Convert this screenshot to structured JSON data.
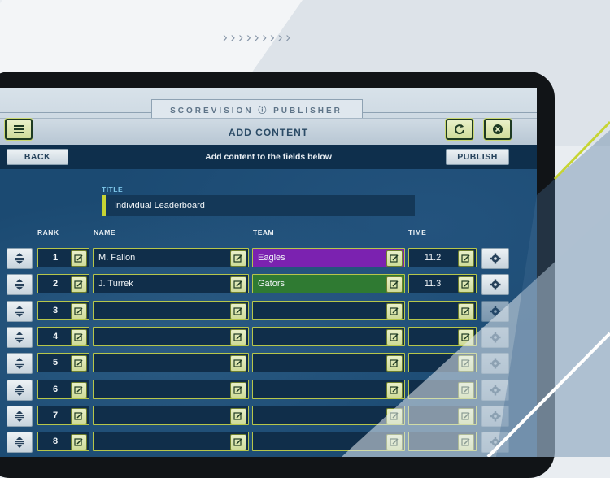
{
  "brand": "SCOREVISION ⓘ PUBLISHER",
  "page_title": "ADD CONTENT",
  "back_label": "BACK",
  "publish_label": "PUBLISH",
  "instruction": "Add content to the fields below",
  "title_label": "TITLE",
  "title_value": "Individual Leaderboard",
  "columns": {
    "rank": "RANK",
    "name": "NAME",
    "team": "TEAM",
    "time": "TIME"
  },
  "colors": {
    "accent": "#c6d434",
    "eagles": "#7b22b0",
    "gators": "#2f7a32",
    "screen_bg": "#1b4a72"
  },
  "icons": [
    "menu-icon",
    "refresh-icon",
    "close-icon",
    "drag-icon",
    "edit-icon",
    "gear-icon"
  ],
  "rows": [
    {
      "rank": "1",
      "name": "M. Fallon",
      "team": "Eagles",
      "team_color": "#7b22b0",
      "time": "11.2"
    },
    {
      "rank": "2",
      "name": "J. Turrek",
      "team": "Gators",
      "team_color": "#2f7a32",
      "time": "11.3"
    },
    {
      "rank": "3",
      "name": "",
      "team": "",
      "team_color": "",
      "time": ""
    },
    {
      "rank": "4",
      "name": "",
      "team": "",
      "team_color": "",
      "time": ""
    },
    {
      "rank": "5",
      "name": "",
      "team": "",
      "team_color": "",
      "time": ""
    },
    {
      "rank": "6",
      "name": "",
      "team": "",
      "team_color": "",
      "time": ""
    },
    {
      "rank": "7",
      "name": "",
      "team": "",
      "team_color": "",
      "time": ""
    },
    {
      "rank": "8",
      "name": "",
      "team": "",
      "team_color": "",
      "time": ""
    }
  ]
}
